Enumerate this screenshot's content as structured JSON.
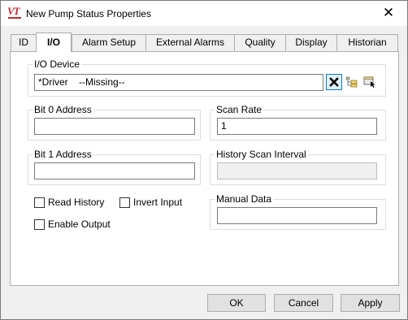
{
  "window": {
    "title": "New Pump Status Properties",
    "close_glyph": "✕"
  },
  "tabs": [
    {
      "label": "ID"
    },
    {
      "label": "I/O"
    },
    {
      "label": "Alarm Setup"
    },
    {
      "label": "External Alarms"
    },
    {
      "label": "Quality"
    },
    {
      "label": "Display"
    },
    {
      "label": "Historian"
    }
  ],
  "active_tab": "I/O",
  "io_device": {
    "label": "I/O Device",
    "value": "*Driver    --Missing--",
    "buttons": [
      "clear-icon",
      "browse-tree-icon",
      "select-device-icon"
    ]
  },
  "bit0": {
    "label": "Bit 0 Address",
    "value": ""
  },
  "bit1": {
    "label": "Bit 1 Address",
    "value": ""
  },
  "scan_rate": {
    "label": "Scan Rate",
    "value": "1"
  },
  "history_scan_interval": {
    "label": "History Scan Interval",
    "value": ""
  },
  "manual_data": {
    "label": "Manual Data",
    "value": ""
  },
  "options": {
    "read_history": {
      "label": "Read History",
      "checked": false
    },
    "invert_input": {
      "label": "Invert Input",
      "checked": false
    },
    "enable_output": {
      "label": "Enable Output",
      "checked": false
    }
  },
  "footer": {
    "ok": "OK",
    "cancel": "Cancel",
    "apply": "Apply"
  },
  "colors": {
    "accent": "#0078d7",
    "brand": "#c0282c"
  }
}
